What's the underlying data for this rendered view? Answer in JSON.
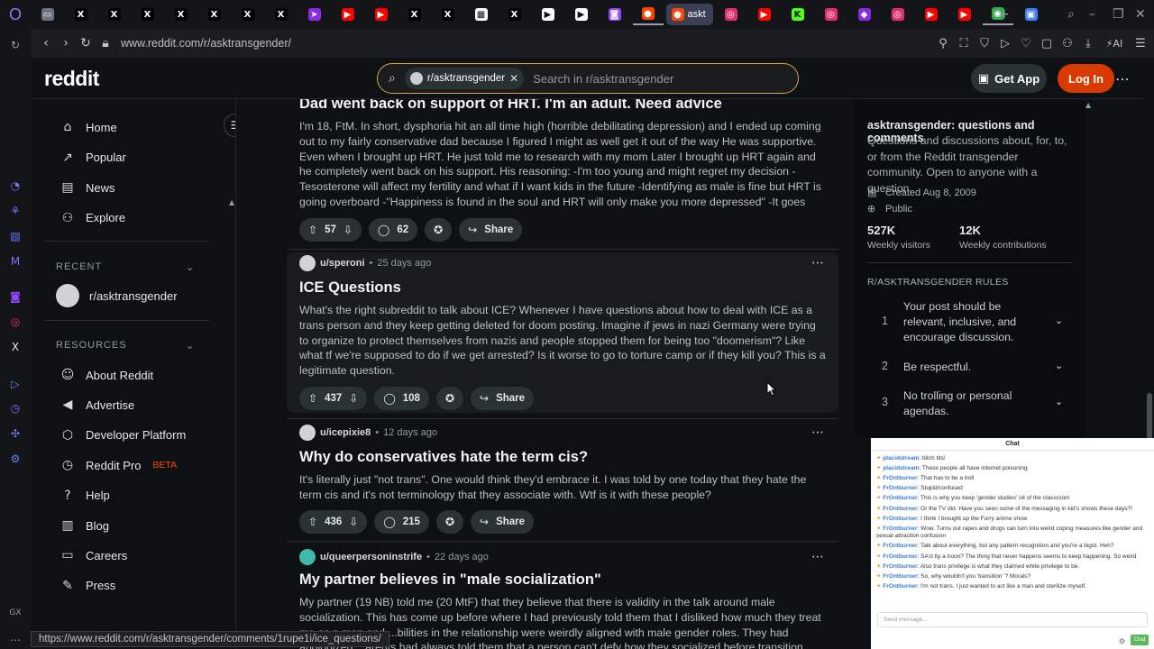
{
  "browser": {
    "url": "www.reddit.com/r/asktransgender/",
    "active_tab_label": "askt",
    "status_url": "https://www.reddit.com/r/asktransgender/comments/1rupe1i/ice_questions/",
    "sidebar_label": "GX",
    "tabs": [
      {
        "icon": "generic-tab-icon",
        "color": "#6b7280",
        "glyph": "▭"
      },
      {
        "icon": "x-logo-icon",
        "color": "#000000",
        "glyph": "X"
      },
      {
        "icon": "x-logo-icon",
        "color": "#000000",
        "glyph": "X"
      },
      {
        "icon": "x-logo-icon",
        "color": "#000000",
        "glyph": "X"
      },
      {
        "icon": "x-logo-icon",
        "color": "#000000",
        "glyph": "X"
      },
      {
        "icon": "x-logo-icon",
        "color": "#000000",
        "glyph": "X"
      },
      {
        "icon": "x-logo-icon",
        "color": "#000000",
        "glyph": "X"
      },
      {
        "icon": "x-logo-icon",
        "color": "#000000",
        "glyph": "X"
      },
      {
        "icon": "generic-tab-icon",
        "color": "#8a2be2",
        "glyph": "➤"
      },
      {
        "icon": "youtube-icon",
        "color": "#ff0000",
        "glyph": "▶"
      },
      {
        "icon": "youtube-icon",
        "color": "#ff0000",
        "glyph": "▶"
      },
      {
        "icon": "x-logo-icon",
        "color": "#000000",
        "glyph": "X"
      },
      {
        "icon": "x-logo-icon",
        "color": "#000000",
        "glyph": "X"
      },
      {
        "icon": "news-tab-icon",
        "color": "#ffffff",
        "glyph": "▦"
      },
      {
        "icon": "x-logo-icon",
        "color": "#000000",
        "glyph": "X"
      },
      {
        "icon": "play-tab-icon",
        "color": "#ffffff",
        "glyph": "▶"
      },
      {
        "icon": "play-tab-icon",
        "color": "#ffffff",
        "glyph": "▶"
      },
      {
        "icon": "twitch-icon",
        "color": "#9146ff",
        "glyph": "◙"
      },
      {
        "icon": "reddit-icon",
        "color": "#ff4500",
        "glyph": "●"
      },
      {
        "icon": "reddit-icon",
        "color": "#ff4500",
        "glyph": "●"
      },
      {
        "icon": "instagram-icon",
        "color": "#e1306c",
        "glyph": "◎"
      },
      {
        "icon": "youtube-icon",
        "color": "#ff0000",
        "glyph": "▶"
      },
      {
        "icon": "kick-icon",
        "color": "#53fc18",
        "glyph": "K"
      },
      {
        "icon": "instagram-icon",
        "color": "#e1306c",
        "glyph": "◎"
      },
      {
        "icon": "generic-tab-icon",
        "color": "#8a2be2",
        "glyph": "◆"
      },
      {
        "icon": "instagram-icon",
        "color": "#e1306c",
        "glyph": "◎"
      },
      {
        "icon": "youtube-icon",
        "color": "#ff0000",
        "glyph": "▶"
      },
      {
        "icon": "youtube-icon",
        "color": "#ff0000",
        "glyph": "▶"
      },
      {
        "icon": "chrome-icon",
        "color": "#34a853",
        "glyph": "◉"
      },
      {
        "icon": "generic-tab-icon",
        "color": "#3b82f6",
        "glyph": "▣"
      }
    ]
  },
  "header": {
    "logo": "reddit",
    "search_chip": "r/asktransgender",
    "search_placeholder": "Search in r/asktransgender",
    "get_app": "Get App",
    "login": "Log In"
  },
  "leftnav": {
    "items": [
      {
        "label": "Home",
        "icon": "home-icon",
        "glyph": "⌂"
      },
      {
        "label": "Popular",
        "icon": "popular-icon",
        "glyph": "↗"
      },
      {
        "label": "News",
        "icon": "news-icon",
        "glyph": "▤"
      },
      {
        "label": "Explore",
        "icon": "explore-icon",
        "glyph": "⚇"
      }
    ],
    "recent_header": "RECENT",
    "recent_item": "r/asktransgender",
    "resources_header": "RESOURCES",
    "resources": [
      {
        "label": "About Reddit",
        "icon": "reddit-alien-icon",
        "glyph": "☺"
      },
      {
        "label": "Advertise",
        "icon": "megaphone-icon",
        "glyph": "◀"
      },
      {
        "label": "Developer Platform",
        "icon": "developer-icon",
        "glyph": "⬡"
      },
      {
        "label": "Reddit Pro",
        "icon": "reddit-pro-icon",
        "glyph": "◷",
        "badge": "BETA"
      },
      {
        "label": "Help",
        "icon": "help-icon",
        "glyph": "?"
      },
      {
        "label": "Blog",
        "icon": "blog-icon",
        "glyph": "▥"
      },
      {
        "label": "Careers",
        "icon": "careers-icon",
        "glyph": "▭"
      },
      {
        "label": "Press",
        "icon": "press-icon",
        "glyph": "✎"
      }
    ]
  },
  "feed": {
    "posts": [
      {
        "title": "Dad went back on support of HRT. I'm an adult. Need advice",
        "body": "I'm 18, FtM. In short, dysphoria hit an all time high (horrible debilitating depression) and I ended up coming out to my fairly conservative dad because I figured I might as well get it out of the way He was supportive. Even when I brought up HRT. He just told me to research with my mom Later I brought up HRT again and he completely went back on his support. His reasoning: -I'm too young and might regret my decision -Tesosterone will affect my fertility and what if I want kids in the future -Identifying as male is fine but HRT is going overboard -\"Happiness is found in the soul and HRT will only make you more depressed\" -It goes against all religions I feel...",
        "votes": "57",
        "comments": "62",
        "share": "Share"
      },
      {
        "user": "u/speroni",
        "age": "25 days ago",
        "title": "ICE Questions",
        "body": "What's the right subreddit to talk about ICE? Whenever I have questions about how to deal with ICE as a trans person and they keep getting deleted for doom posting. Imagine if jews in nazi Germany were trying to organize to protect themselves from nazis and people stopped them for being too \"doomerism\"? Like what tf we're supposed to do if we get arrested? Is it worse to go to torture camp or if they kill you? This is a legitimate question.",
        "votes": "437",
        "comments": "108",
        "share": "Share"
      },
      {
        "user": "u/icepixie8",
        "age": "12 days ago",
        "title": "Why do conservatives hate the term cis?",
        "body": "It's literally just \"not trans\". One would think they'd embrace it. I was told by one today that they hate the term cis and it's not terminology that they associate with. Wtf is it with these people?",
        "votes": "436",
        "comments": "215",
        "share": "Share"
      },
      {
        "user": "u/queerpersoninstrife",
        "age": "22 days ago",
        "title": "My partner believes in \"male socialization\"",
        "body": "My partner (19 NB) told me (20 MtF) that they believe that there is validity in the talk around male socialization. This has come up before where I had previously told them that I disliked how much they treat me as a man and ...bilities in the relationship were weirdly aligned with male gender roles. They had apologized ...arents had always told them that a person can't defy how they socialized before transition..."
      }
    ]
  },
  "sidebar": {
    "name": "asktransgender: questions and comments",
    "description": "Questions and discussions about, for, to, or from the Reddit transgender community. Open to anyone with a question.",
    "created": "Created Aug 8, 2009",
    "visibility": "Public",
    "stats": [
      {
        "value": "527K",
        "label": "Weekly visitors"
      },
      {
        "value": "12K",
        "label": "Weekly contributions"
      }
    ],
    "rules_header": "R/ASKTRANSGENDER RULES",
    "rules": [
      {
        "n": "1",
        "text": "Your post should be relevant, inclusive, and encourage discussion."
      },
      {
        "n": "2",
        "text": "Be respectful."
      },
      {
        "n": "3",
        "text": "No trolling or personal agendas."
      }
    ]
  },
  "chat": {
    "title": "Chat",
    "input_placeholder": "Send message...",
    "send": "Chat",
    "messages": [
      {
        "user": "placidstream",
        "text": "bitch tits!"
      },
      {
        "user": "placidstream",
        "text": "These people all have internet poisoning"
      },
      {
        "user": "FrOntburner",
        "text": "That has to be a troll"
      },
      {
        "user": "FrOntburner",
        "text": "Stupid/confused"
      },
      {
        "user": "FrOntburner",
        "text": "This is why you keep 'gender studies' oit of the classroom"
      },
      {
        "user": "FrOntburner",
        "text": "Or the TV did. Have you seen some of the messaging in kid's shows these days?!"
      },
      {
        "user": "FrOntburner",
        "text": "I think I brought up the Furry anime show"
      },
      {
        "user": "FrOntburner",
        "text": "Wow. Turns out rapes and drugs can turn into weird coping measures like gender and sexual attraction confusion"
      },
      {
        "user": "FrOntburner",
        "text": "Talk about everything, but any pattern recognition and you're a bigot. Heh?"
      },
      {
        "user": "FrOntburner",
        "text": "SA'd by a troon? The thing that never happens seems to keep happening. So weird"
      },
      {
        "user": "FrOntburner",
        "text": "Also trans privilege is what they claimed white privilege to be."
      },
      {
        "user": "FrOntburner",
        "text": "So, why wouldn't you 'transition' ? Morals?"
      },
      {
        "user": "FrOntburner",
        "text": "I'm not trans. I just wanted to act like a man and sterilize myself."
      }
    ]
  }
}
